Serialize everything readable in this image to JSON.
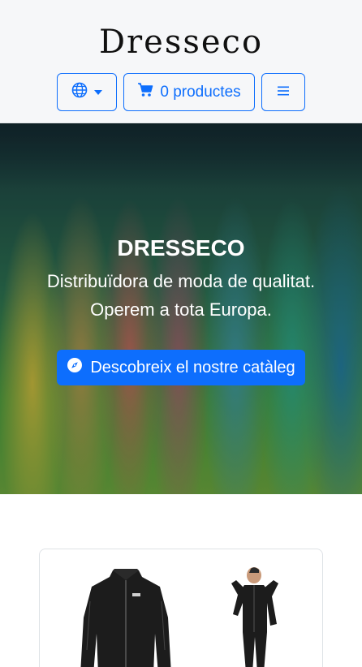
{
  "header": {
    "logo_text": "Dresseco",
    "language_button": {
      "icon": "globe-icon"
    },
    "cart_button": {
      "icon": "cart-icon",
      "label": "0 productes"
    },
    "menu_button": {
      "icon": "hamburger-icon"
    }
  },
  "hero": {
    "title": "DRESSECO",
    "line1": "Distribuïdora de moda de qualitat.",
    "line2": "Operem a tota Europa.",
    "cta": {
      "icon": "compass-icon",
      "label": "Descobreix el nostre catàleg"
    }
  },
  "product_card": {
    "images": [
      "black-tracksuit-jacket-image",
      "model-wearing-tracksuit-image"
    ]
  },
  "colors": {
    "accent": "#0d6efd",
    "header_bg": "#f6f7f9"
  }
}
